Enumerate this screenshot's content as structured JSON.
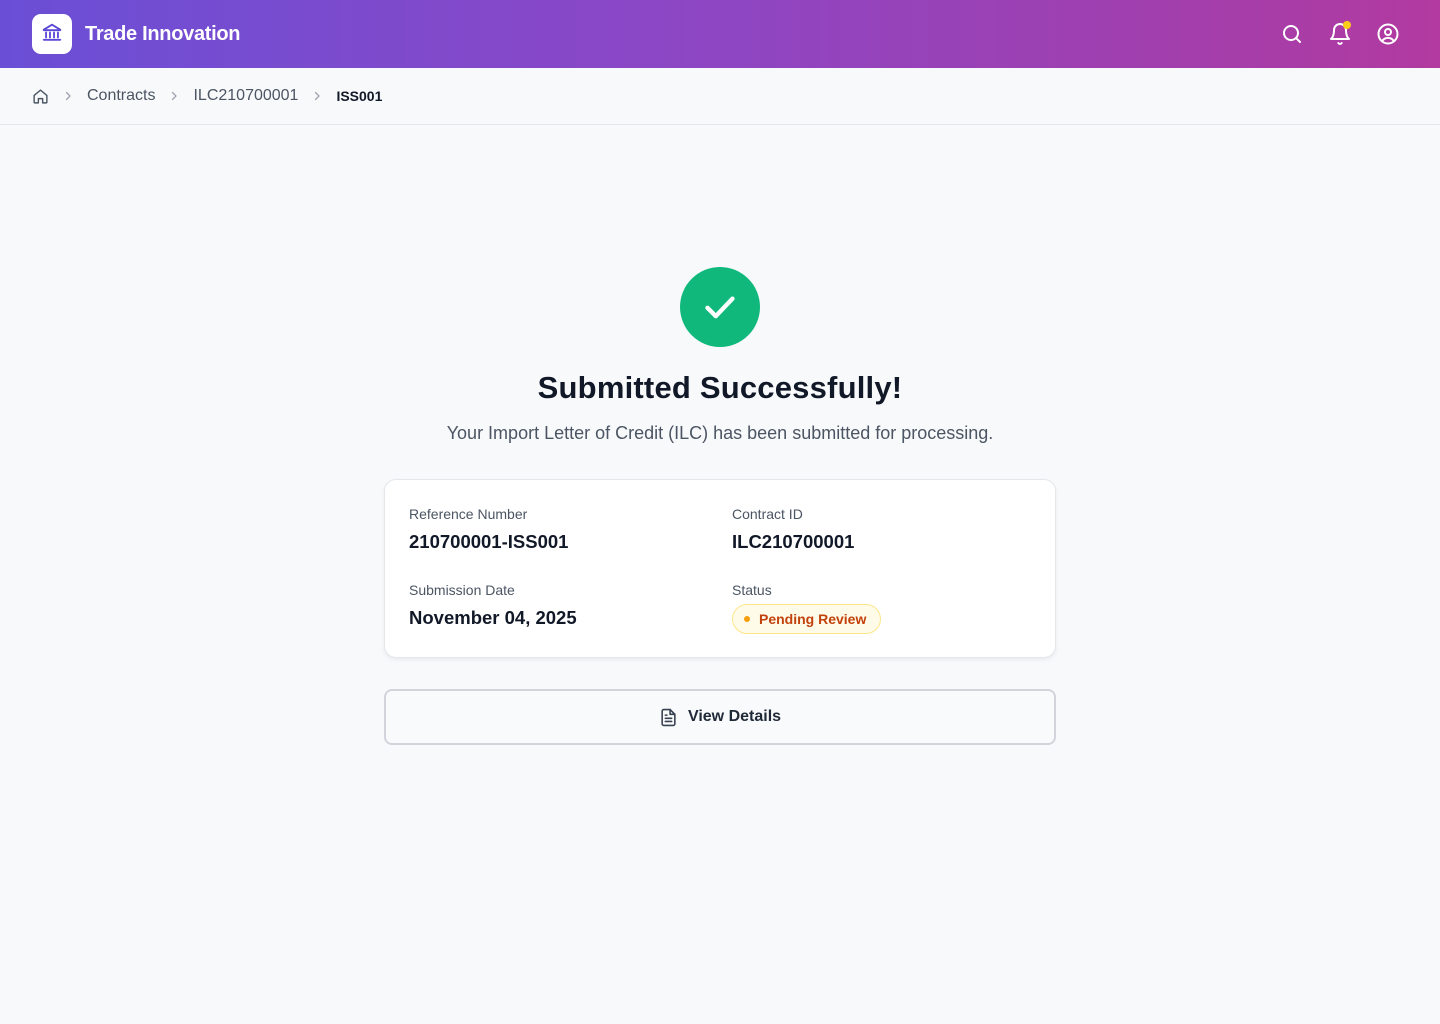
{
  "header": {
    "brand_name": "Trade Innovation",
    "logo_icon": "bank-icon",
    "actions": [
      {
        "name": "search-icon"
      },
      {
        "name": "bell-icon",
        "has_notification": true
      },
      {
        "name": "user-circle-icon"
      }
    ],
    "gradient_colors": [
      "#6a4fd6",
      "#b23aa0"
    ],
    "notification_dot_color": "#facc15"
  },
  "breadcrumb": {
    "home_icon": "home-icon",
    "items": [
      "Contracts",
      "ILC210700001"
    ],
    "current": "ISS001"
  },
  "success": {
    "icon": "check-icon",
    "color": "#10b97b",
    "title": "Submitted Successfully!",
    "message": "Your Import Letter of Credit (ILC) has been submitted for processing."
  },
  "details": {
    "reference_label": "Reference Number",
    "reference_value": "210700001-ISS001",
    "contract_label": "Contract ID",
    "contract_value": "ILC210700001",
    "date_label": "Submission Date",
    "date_value": "November 04, 2025",
    "status_label": "Status",
    "status_value": "Pending Review",
    "status_color": "#c2410c"
  },
  "actions": {
    "view_details_label": "View Details",
    "view_details_icon": "document-icon"
  }
}
